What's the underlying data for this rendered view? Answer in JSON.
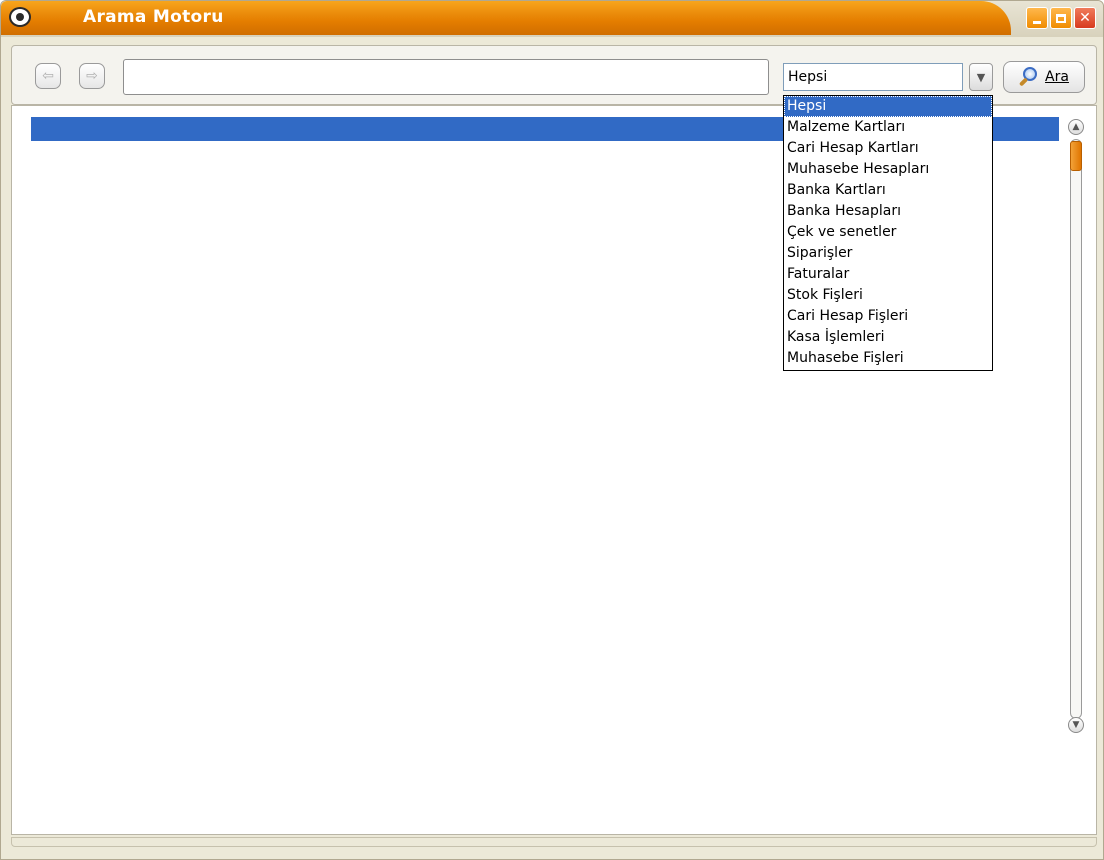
{
  "window": {
    "title": "Arama Motoru",
    "icons": {
      "app": "eye-icon",
      "minimize": "minimize-icon",
      "maximize": "maximize-icon",
      "close": "close-icon"
    }
  },
  "toolbar": {
    "back_icon": "arrow-left-icon",
    "forward_icon": "arrow-right-icon",
    "search": {
      "value": "",
      "placeholder": ""
    },
    "category": {
      "selected": "Hepsi",
      "options": [
        "Hepsi",
        "Malzeme Kartları",
        "Cari Hesap Kartları",
        "Muhasebe Hesapları",
        "Banka Kartları",
        "Banka Hesapları",
        "Çek ve senetler",
        "Siparişler",
        "Faturalar",
        "Stok Fişleri",
        "Cari Hesap Fişleri",
        "Kasa İşlemleri",
        "Muhasebe Fişleri"
      ]
    },
    "search_button_label": "Ara",
    "search_button_icon": "magnifier-icon"
  },
  "colors": {
    "title_orange": "#e47d00",
    "selection_blue": "#316ac5",
    "scroll_thumb": "#e07500"
  }
}
